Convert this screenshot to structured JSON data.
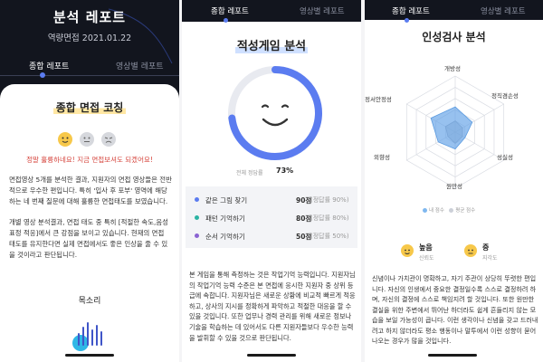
{
  "colors": {
    "dark": "#12151e",
    "accent": "#5b7cf0",
    "red": "#d6453d",
    "yellow": "#f7c84a"
  },
  "phone1": {
    "title": "분석 레포트",
    "subtitle": "역량면접  2021.01.22",
    "tabs": [
      "종합 레포트",
      "영상별 레포트"
    ],
    "card_title": "종합 면접 코칭",
    "faces": [
      "smile-face-icon",
      "neutral-face-icon",
      "sad-face-icon"
    ],
    "emphasis": "정말 훌륭하네요! 지금 면접보셔도 되겠어요!",
    "para1": "면접영상 5개를 분석한 결과, 지원자의 면접 영상들은 전반적으로 우수한 편입니다. 특히 '입사 후 포부' 영역에 해당하는 네 번째 질문에 대해 훌륭한 면접태도를 보였습니다.",
    "para2": "개별 영상 분석결과, 면접 태도 중 특히 [적절한 속도,음성 표정 적응]에서 큰 강점을 보이고 있습니다. 현재의 면접 태도를 유지한다면 실제 면접에서도 좋은 인상을 줄 수 있을 것이라고 판단됩니다.",
    "voice_label": "목소리",
    "voice_bars": [
      0.55,
      0.8,
      1.0,
      0.7,
      0.9,
      0.6
    ]
  },
  "phone2": {
    "tabs": [
      "종합 레포트",
      "영상별 레포트"
    ],
    "title": "적성게임 분석",
    "percentile_label": "전체 정답률",
    "percentile": "73%",
    "gauge_value": 0.73,
    "games": [
      {
        "name": "같은 그림 찾기",
        "score": "90점",
        "avg": "(정답률 90%)",
        "color": "#5b7cf0"
      },
      {
        "name": "패턴 기억하기",
        "score": "80점",
        "avg": "(정답률 80%)",
        "color": "#2bb3a3"
      },
      {
        "name": "순서 기억하기",
        "score": "50점",
        "avg": "(정답률 50%)",
        "color": "#8a63d2"
      }
    ],
    "para": "본 게임을 통해 측정하는 것은 작업기억 능력입니다. 지원자님의 작업기억 능력 수준은 본 면접에 응시한 지원자 중 상위 등급에 속합니다. 지원자님은 새로운 상황에 비교적 빠르게 적응하고, 상사의 지시를 정확하게 파악하고 적절한 대응을 할 수 있을 것입니다. 또한 업무나 경력 관리를 위해 새로운 정보나 기술을 학습하는 데 있어서도 다른 지원자들보다 우수한 능력을 발휘할 수 있을 것으로 판단됩니다."
  },
  "phone3": {
    "tabs": [
      "종합 레포트",
      "영상별 레포트"
    ],
    "title": "인성검사 분석",
    "axes": [
      "개방성",
      "정직겸손성",
      "성실성",
      "원만성",
      "외향성",
      "정서안정성"
    ],
    "my_values": [
      0.45,
      0.35,
      0.2,
      0.3,
      0.35,
      0.5
    ],
    "avg_values": [
      0.2,
      0.15,
      0.15,
      0.2,
      0.15,
      0.2
    ],
    "legend": [
      "내 점수",
      "평균 점수"
    ],
    "levels": [
      {
        "value": "높음",
        "key": "신뢰도",
        "color": "#f7c84a"
      },
      {
        "value": "중",
        "key": "지각도",
        "color": "#f7c84a"
      }
    ],
    "para": "신념이나 가치관이 명확하고, 자기 주관이 상당히 뚜렷한 편입니다. 자신의 인생에서 중요한 결정일수록 스스로 결정하려 하며, 자신의 결정에 스스로 책임지려 할 것입니다. 또한 원만한 결실을 위한 주변에서 뛰어난 하더라도 쉽게 흔들리지 않는 모습을 보일 가능성이 큽니다. 이런 생각이나 신념을 갖고 드러내려고 하지 않더라도 평소 행동이나 말투에서 이런 성향이 묻어나오는 경우가 많을 것입니다."
  }
}
